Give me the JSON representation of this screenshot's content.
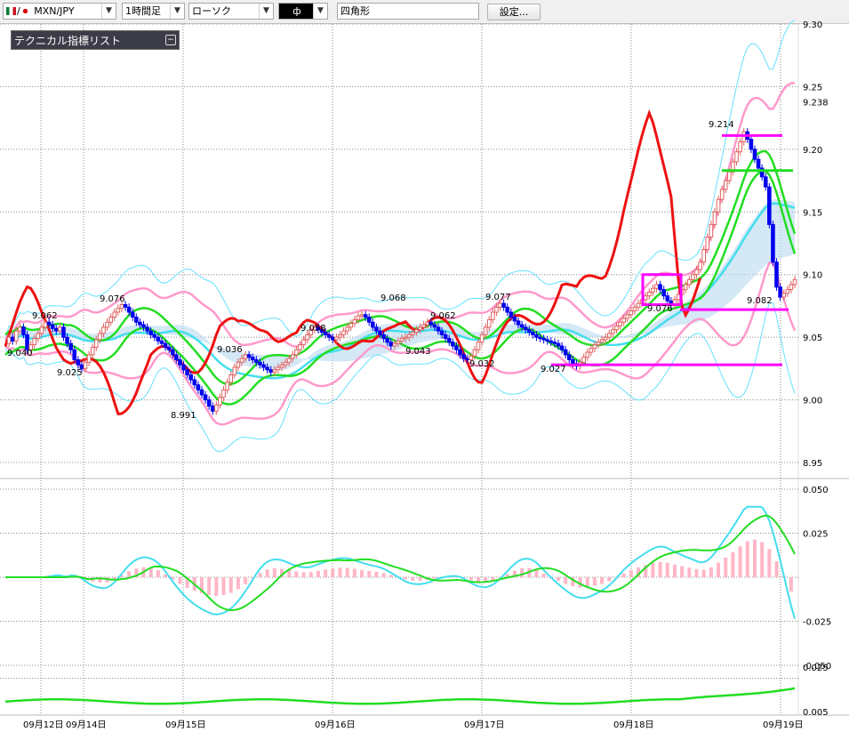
{
  "toolbar": {
    "pair": "MXN/JPY",
    "timeframe": "1時間足",
    "chart_style": "ローソク",
    "draw_tool_icon": "ф",
    "draw_object": "四角形",
    "settings_label": "設定..."
  },
  "indicator_list": {
    "title": "テクニカル指標リスト",
    "collapse_icon": "minus-box-icon"
  },
  "colors": {
    "up_candle": "#e06060",
    "down_candle": "#0000ee",
    "bollinger": "#ff99cc",
    "bollinger_outer": "#66e0ff",
    "ma_green": "#22dd22",
    "ma_cyan": "#44ddee",
    "red_line": "#ee1111",
    "cloud": "#b8d8f0",
    "magenta": "#ff00ff"
  },
  "chart_data": [
    {
      "type": "candlestick",
      "pair": "MXN/JPY",
      "timeframe": "1時間足",
      "y_ticks": [
        "9.30",
        "9.25",
        "9.238",
        "9.20",
        "9.15",
        "9.10",
        "9.05",
        "9.00",
        "8.95"
      ],
      "ylim": [
        8.95,
        9.3
      ],
      "x_ticks": [
        "09月12日",
        "09月14日",
        "09月15日",
        "09月16日",
        "09月17日",
        "09月18日",
        "09月19日"
      ],
      "annotations": [
        {
          "text": "9.040"
        },
        {
          "text": "9.062"
        },
        {
          "text": "9.025"
        },
        {
          "text": "9.076"
        },
        {
          "text": "8.991"
        },
        {
          "text": "9.036"
        },
        {
          "text": "9.058"
        },
        {
          "text": "9.068"
        },
        {
          "text": "9.043"
        },
        {
          "text": "9.062"
        },
        {
          "text": "9.032"
        },
        {
          "text": "9.077"
        },
        {
          "text": "9.027"
        },
        {
          "text": "9.076"
        },
        {
          "text": "9.214"
        },
        {
          "text": "9.082"
        }
      ],
      "horizontal_lines": [
        9.211,
        9.183,
        9.072,
        9.028
      ],
      "rectangle": {
        "y_low": 9.076,
        "y_high": 9.1
      },
      "closes": [
        9.045,
        9.05,
        9.047,
        9.055,
        9.058,
        9.052,
        9.04,
        9.044,
        9.049,
        9.053,
        9.058,
        9.062,
        9.06,
        9.057,
        9.055,
        9.058,
        9.05,
        9.045,
        9.04,
        9.032,
        9.028,
        9.025,
        9.03,
        9.036,
        9.042,
        9.048,
        9.053,
        9.058,
        9.062,
        9.066,
        9.07,
        9.073,
        9.076,
        9.074,
        9.07,
        9.066,
        9.062,
        9.06,
        9.058,
        9.055,
        9.052,
        9.05,
        9.047,
        9.045,
        9.042,
        9.04,
        9.036,
        9.032,
        9.028,
        9.024,
        9.02,
        9.016,
        9.012,
        9.008,
        9.004,
        9.0,
        8.995,
        8.991,
        8.996,
        9.002,
        9.008,
        9.014,
        9.02,
        9.026,
        9.03,
        9.033,
        9.036,
        9.034,
        9.032,
        9.03,
        9.028,
        9.026,
        9.024,
        9.022,
        9.024,
        9.026,
        9.028,
        9.03,
        9.033,
        9.036,
        9.04,
        9.044,
        9.048,
        9.052,
        9.056,
        9.058,
        9.056,
        9.054,
        9.052,
        9.05,
        9.048,
        9.05,
        9.052,
        9.055,
        9.058,
        9.061,
        9.064,
        9.067,
        9.068,
        9.066,
        9.062,
        9.058,
        9.055,
        9.052,
        9.049,
        9.046,
        9.043,
        9.045,
        9.047,
        9.049,
        9.05,
        9.052,
        9.054,
        9.056,
        9.058,
        9.06,
        9.062,
        9.06,
        9.058,
        9.055,
        9.052,
        9.049,
        9.046,
        9.043,
        9.04,
        9.036,
        9.033,
        9.032,
        9.035,
        9.04,
        9.046,
        9.052,
        9.058,
        9.064,
        9.07,
        9.074,
        9.077,
        9.074,
        9.07,
        9.066,
        9.063,
        9.06,
        9.058,
        9.056,
        9.054,
        9.052,
        9.05,
        9.049,
        9.048,
        9.047,
        9.046,
        9.045,
        9.043,
        9.04,
        9.036,
        9.032,
        9.029,
        9.027,
        9.03,
        9.034,
        9.038,
        9.041,
        9.044,
        9.046,
        9.048,
        9.05,
        9.053,
        9.056,
        9.059,
        9.062,
        9.065,
        9.068,
        9.071,
        9.074,
        9.077,
        9.08,
        9.083,
        9.086,
        9.089,
        9.092,
        9.088,
        9.083,
        9.079,
        9.076,
        9.08,
        9.084,
        9.088,
        9.092,
        9.096,
        9.1,
        9.104,
        9.11,
        9.12,
        9.13,
        9.14,
        9.15,
        9.16,
        9.168,
        9.175,
        9.182,
        9.19,
        9.198,
        9.206,
        9.214,
        9.208,
        9.2,
        9.192,
        9.185,
        9.178,
        9.17,
        9.14,
        9.11,
        9.09,
        9.082,
        9.085,
        9.088,
        9.092,
        9.096
      ]
    },
    {
      "type": "histogram+line",
      "name": "MACD",
      "y_ticks": [
        "0.050",
        "0.025",
        "-0.025",
        "-0.050"
      ],
      "ylim": [
        -0.05,
        0.05
      ]
    },
    {
      "type": "line",
      "y_ticks": [
        "0.025",
        "0.005"
      ],
      "ylim": [
        0.005,
        0.025
      ]
    }
  ]
}
